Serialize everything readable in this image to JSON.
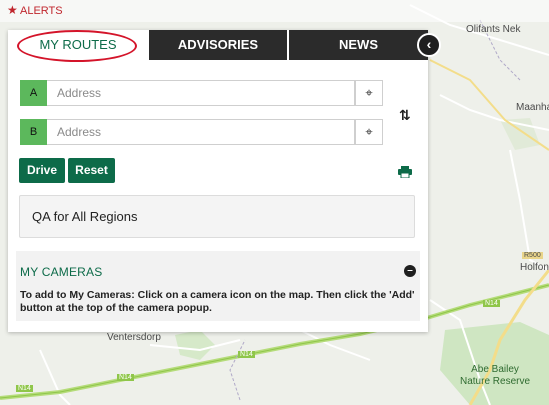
{
  "alerts": {
    "label": "ALERTS",
    "icon": "star-icon"
  },
  "tabs": [
    {
      "label": "MY ROUTES",
      "active": true
    },
    {
      "label": "ADVISORIES",
      "active": false
    },
    {
      "label": "NEWS",
      "active": false
    }
  ],
  "collapse_icon": "chevron-left-icon",
  "route": {
    "from": {
      "badge": "A",
      "placeholder": "Address",
      "value": ""
    },
    "to": {
      "badge": "B",
      "placeholder": "Address",
      "value": ""
    }
  },
  "buttons": {
    "drive": "Drive",
    "reset": "Reset"
  },
  "region": "QA for All Regions",
  "cameras": {
    "title": "MY CAMERAS",
    "instructions": "To add to My Cameras: Click on a camera icon on the map. Then click the 'Add' button at the top of the camera popup."
  },
  "map": {
    "places": [
      "Olifants Nek",
      "Maanhaa",
      "Holfon",
      "Ventersdorp"
    ],
    "reserve": [
      "Abe Bailey",
      "Nature Reserve"
    ],
    "road_labels": [
      "R500",
      "N14",
      "N14",
      "N14",
      "N14"
    ]
  },
  "colors": {
    "accent": "#0d6b49",
    "alert": "#c0262d",
    "badge": "#5cb85c",
    "tab_dark": "#2b2b2b"
  }
}
